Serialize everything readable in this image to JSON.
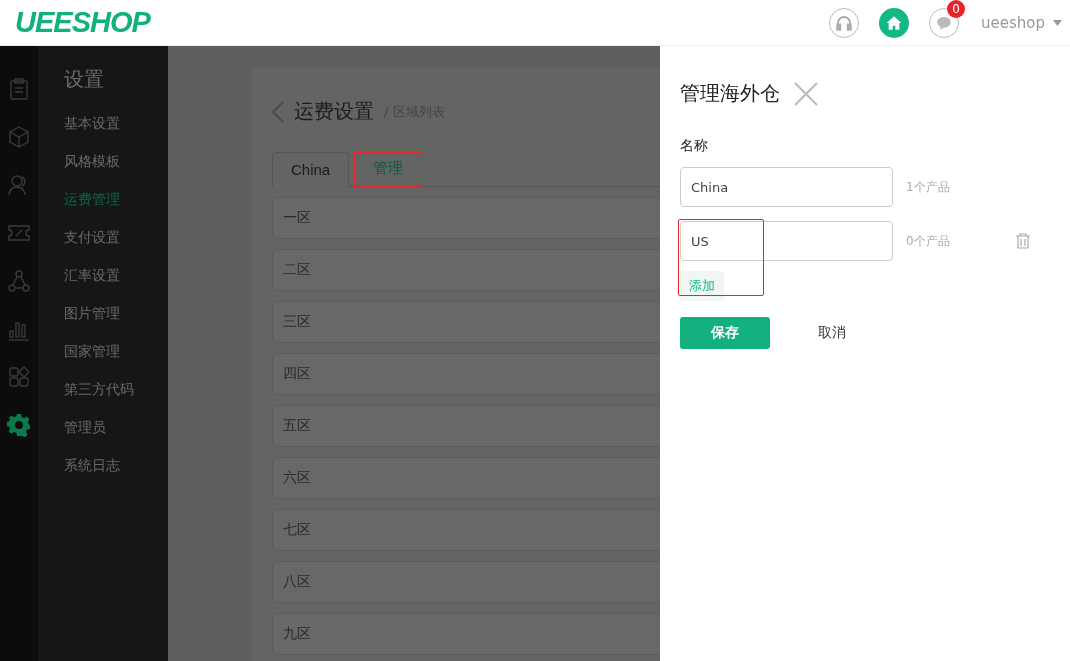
{
  "header": {
    "logo": "UEESHOP",
    "notifications": "0",
    "user": "ueeshop"
  },
  "rail": [
    {
      "kind": "clipboard",
      "selected": false
    },
    {
      "kind": "box",
      "selected": false
    },
    {
      "kind": "users",
      "selected": false
    },
    {
      "kind": "coupon",
      "selected": false
    },
    {
      "kind": "share",
      "selected": false
    },
    {
      "kind": "chart",
      "selected": false
    },
    {
      "kind": "apps",
      "selected": false
    },
    {
      "kind": "gear",
      "selected": true
    }
  ],
  "sidebar": {
    "title": "设置",
    "items": [
      {
        "label": "基本设置",
        "selected": false
      },
      {
        "label": "风格模板",
        "selected": false
      },
      {
        "label": "运费管理",
        "selected": true
      },
      {
        "label": "支付设置",
        "selected": false
      },
      {
        "label": "汇率设置",
        "selected": false
      },
      {
        "label": "图片管理",
        "selected": false
      },
      {
        "label": "国家管理",
        "selected": false
      },
      {
        "label": "第三方代码",
        "selected": false
      },
      {
        "label": "管理员",
        "selected": false
      },
      {
        "label": "系统日志",
        "selected": false
      }
    ]
  },
  "main": {
    "title": "运费设置",
    "breadcrumb": "/ 区域列表",
    "tabs": [
      {
        "label": "China",
        "selected": true
      },
      {
        "label": "管理",
        "selected": false
      }
    ],
    "zones": [
      "一区",
      "二区",
      "三区",
      "四区",
      "五区",
      "六区",
      "七区",
      "八区",
      "九区"
    ]
  },
  "drawer": {
    "title": "管理海外仓",
    "label": "名称",
    "warehouses": [
      {
        "value": "China",
        "count": "1个产品",
        "deletable": false
      },
      {
        "value": "US",
        "count": "0个产品",
        "deletable": true
      }
    ],
    "add": "添加",
    "save": "保存",
    "cancel": "取消"
  }
}
